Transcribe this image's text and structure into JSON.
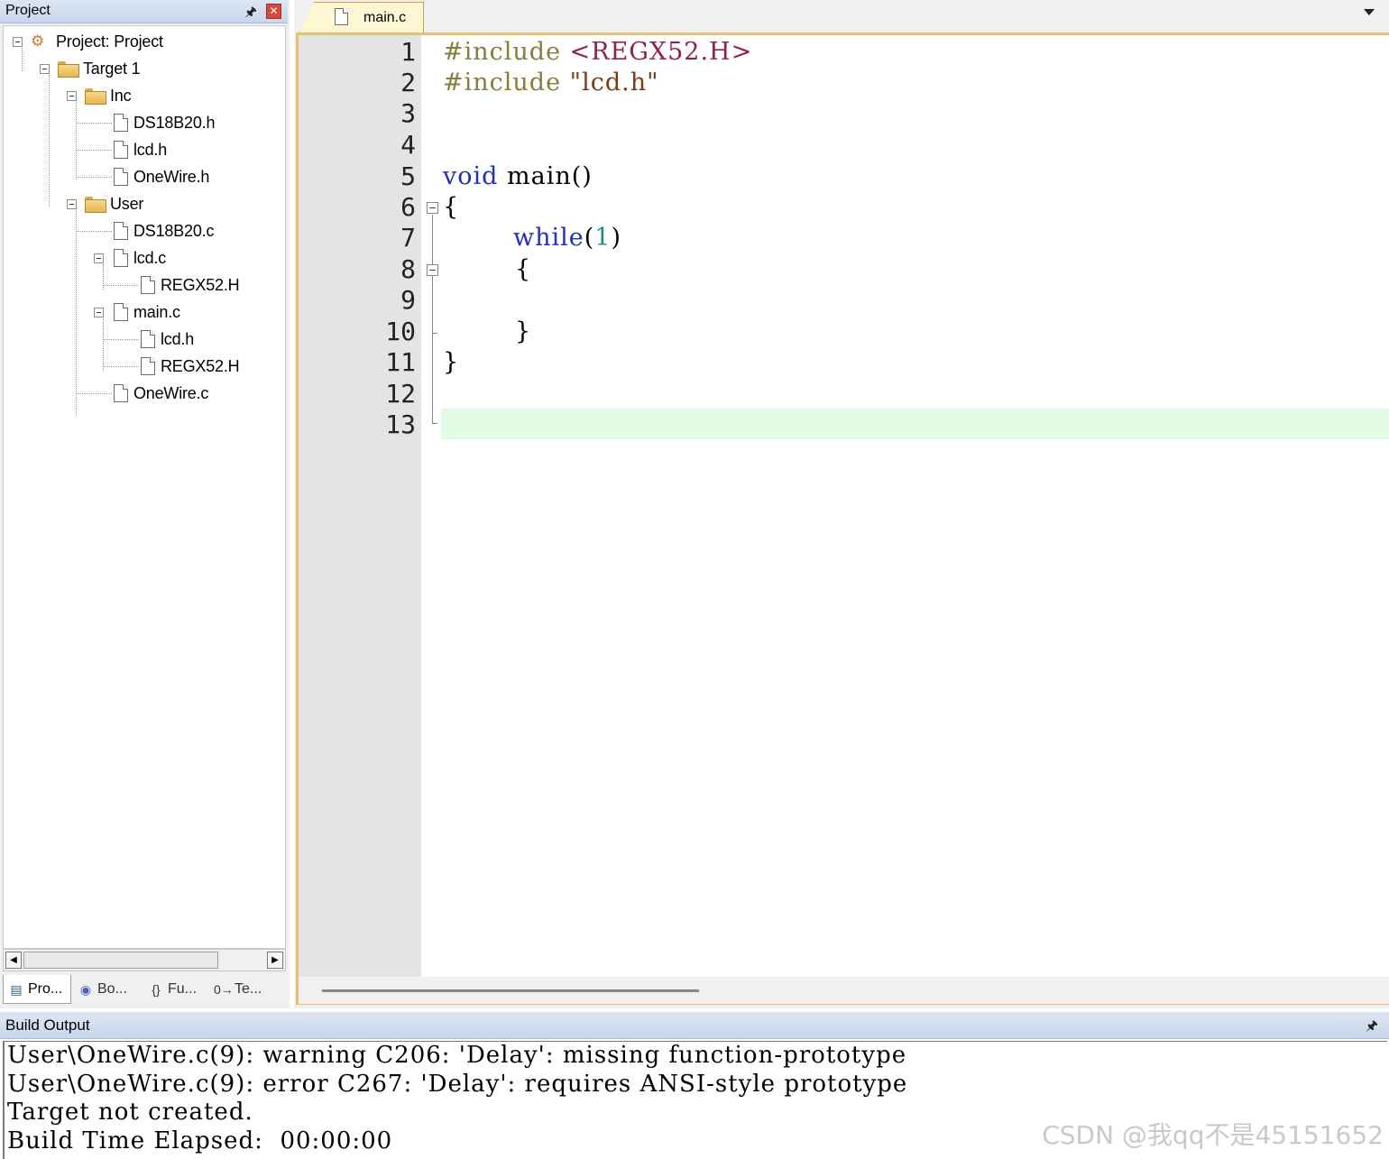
{
  "project_panel": {
    "title": "Project",
    "tree": {
      "project": "Project: Project",
      "target": "Target 1",
      "inc_folder": "Inc",
      "inc_files": [
        "DS18B20.h",
        "lcd.h",
        "OneWire.h"
      ],
      "user_folder": "User",
      "user_ds18b20": "DS18B20.c",
      "user_lcd": "lcd.c",
      "lcd_children": [
        "REGX52.H"
      ],
      "user_main": "main.c",
      "main_children": [
        "lcd.h",
        "REGX52.H"
      ],
      "user_onewire": "OneWire.c"
    },
    "tabs": [
      "Pro...",
      "Bo...",
      "Fu...",
      "Te..."
    ]
  },
  "editor": {
    "active_tab": "main.c",
    "line_numbers": [
      "1",
      "2",
      "3",
      "4",
      "5",
      "6",
      "7",
      "8",
      "9",
      "10",
      "11",
      "12",
      "13"
    ],
    "code": {
      "l1_directive": "#include",
      "l1_target": "<REGX52.H>",
      "l2_directive": "#include",
      "l2_target": "\"lcd.h\"",
      "l5_type": "void",
      "l5_rest": "main()",
      "l6": "{",
      "l7_kw": "while",
      "l7_open": "(",
      "l7_num": "1",
      "l7_close": ")",
      "l8": "{",
      "l10": "}",
      "l11": "}"
    }
  },
  "build_output": {
    "title": "Build Output",
    "lines": [
      "User\\OneWire.c(9): warning C206: 'Delay': missing function-prototype",
      "User\\OneWire.c(9): error C267: 'Delay': requires ANSI-style prototype",
      "Target not created.",
      "Build Time Elapsed:  00:00:00"
    ]
  },
  "watermark": "CSDN @我qq不是45151652",
  "colors": {
    "active_tab": "#fff7d2",
    "editor_border": "#e3c36d",
    "current_line": "#e2fbe2",
    "keyword": "#1f2ec6",
    "preprocessor": "#8a7d3c"
  }
}
